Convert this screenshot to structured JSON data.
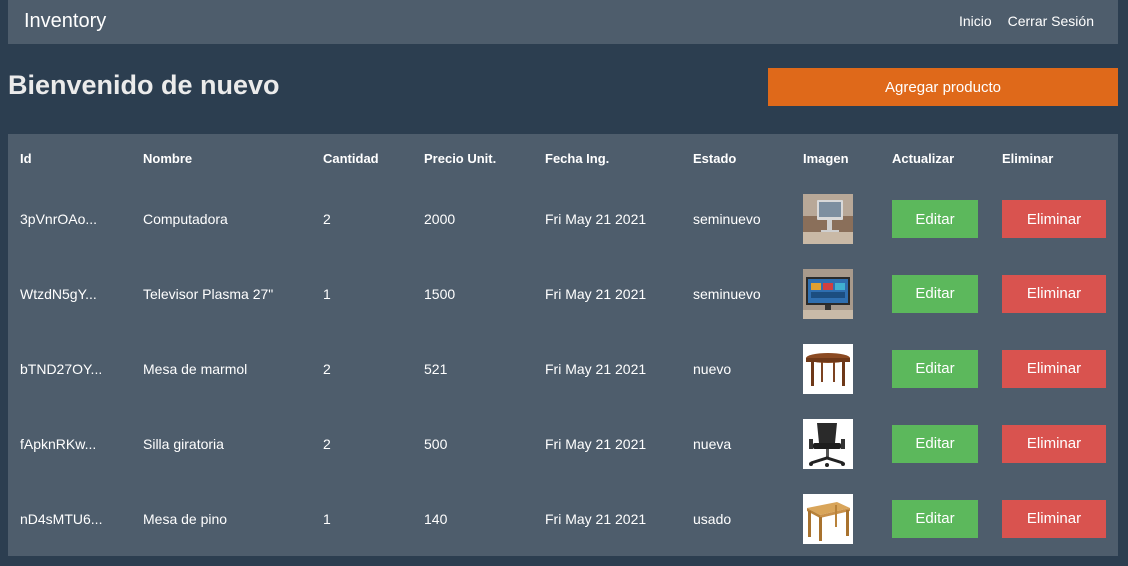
{
  "navbar": {
    "brand": "Inventory",
    "links": [
      "Inicio",
      "Cerrar Sesión"
    ]
  },
  "page": {
    "title": "Bienvenido de nuevo",
    "add_button": "Agregar producto"
  },
  "table": {
    "headers": [
      "Id",
      "Nombre",
      "Cantidad",
      "Precio Unit.",
      "Fecha Ing.",
      "Estado",
      "Imagen",
      "Actualizar",
      "Eliminar"
    ],
    "edit_label": "Editar",
    "delete_label": "Eliminar",
    "rows": [
      {
        "id": "3pVnrOAo...",
        "nombre": "Computadora",
        "cantidad": "2",
        "precio": "2000",
        "fecha": "Fri May 21 2021",
        "estado": "seminuevo",
        "imagen": "computer"
      },
      {
        "id": "WtzdN5gY...",
        "nombre": "Televisor Plasma 27\"",
        "cantidad": "1",
        "precio": "1500",
        "fecha": "Fri May 21 2021",
        "estado": "seminuevo",
        "imagen": "tv"
      },
      {
        "id": "bTND27OY...",
        "nombre": "Mesa de marmol",
        "cantidad": "2",
        "precio": "521",
        "fecha": "Fri May 21 2021",
        "estado": "nuevo",
        "imagen": "round-table"
      },
      {
        "id": "fApknRKw...",
        "nombre": "Silla giratoria",
        "cantidad": "2",
        "precio": "500",
        "fecha": "Fri May 21 2021",
        "estado": "nueva",
        "imagen": "chair"
      },
      {
        "id": "nD4sMTU6...",
        "nombre": "Mesa de pino",
        "cantidad": "1",
        "precio": "140",
        "fecha": "Fri May 21 2021",
        "estado": "usado",
        "imagen": "wood-table"
      }
    ]
  },
  "colors": {
    "background": "#2c3e50",
    "panel": "#4e5d6c",
    "primary": "#df691a",
    "success": "#5cb85c",
    "danger": "#d9534f"
  }
}
